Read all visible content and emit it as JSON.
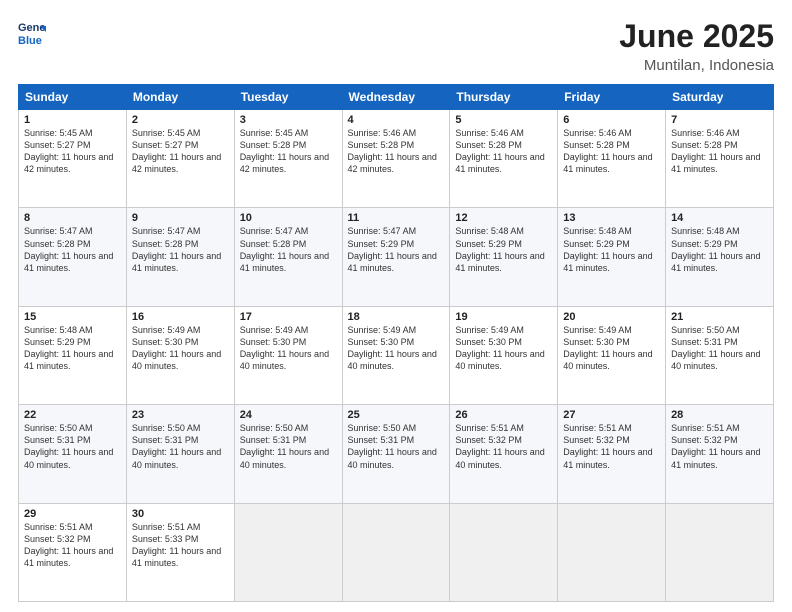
{
  "header": {
    "logo_line1": "General",
    "logo_line2": "Blue",
    "title": "June 2025",
    "subtitle": "Muntilan, Indonesia"
  },
  "days_of_week": [
    "Sunday",
    "Monday",
    "Tuesday",
    "Wednesday",
    "Thursday",
    "Friday",
    "Saturday"
  ],
  "weeks": [
    [
      {
        "day": "1",
        "sunrise": "5:45 AM",
        "sunset": "5:27 PM",
        "daylight": "11 hours and 42 minutes."
      },
      {
        "day": "2",
        "sunrise": "5:45 AM",
        "sunset": "5:27 PM",
        "daylight": "11 hours and 42 minutes."
      },
      {
        "day": "3",
        "sunrise": "5:45 AM",
        "sunset": "5:28 PM",
        "daylight": "11 hours and 42 minutes."
      },
      {
        "day": "4",
        "sunrise": "5:46 AM",
        "sunset": "5:28 PM",
        "daylight": "11 hours and 42 minutes."
      },
      {
        "day": "5",
        "sunrise": "5:46 AM",
        "sunset": "5:28 PM",
        "daylight": "11 hours and 41 minutes."
      },
      {
        "day": "6",
        "sunrise": "5:46 AM",
        "sunset": "5:28 PM",
        "daylight": "11 hours and 41 minutes."
      },
      {
        "day": "7",
        "sunrise": "5:46 AM",
        "sunset": "5:28 PM",
        "daylight": "11 hours and 41 minutes."
      }
    ],
    [
      {
        "day": "8",
        "sunrise": "5:47 AM",
        "sunset": "5:28 PM",
        "daylight": "11 hours and 41 minutes."
      },
      {
        "day": "9",
        "sunrise": "5:47 AM",
        "sunset": "5:28 PM",
        "daylight": "11 hours and 41 minutes."
      },
      {
        "day": "10",
        "sunrise": "5:47 AM",
        "sunset": "5:28 PM",
        "daylight": "11 hours and 41 minutes."
      },
      {
        "day": "11",
        "sunrise": "5:47 AM",
        "sunset": "5:29 PM",
        "daylight": "11 hours and 41 minutes."
      },
      {
        "day": "12",
        "sunrise": "5:48 AM",
        "sunset": "5:29 PM",
        "daylight": "11 hours and 41 minutes."
      },
      {
        "day": "13",
        "sunrise": "5:48 AM",
        "sunset": "5:29 PM",
        "daylight": "11 hours and 41 minutes."
      },
      {
        "day": "14",
        "sunrise": "5:48 AM",
        "sunset": "5:29 PM",
        "daylight": "11 hours and 41 minutes."
      }
    ],
    [
      {
        "day": "15",
        "sunrise": "5:48 AM",
        "sunset": "5:29 PM",
        "daylight": "11 hours and 41 minutes."
      },
      {
        "day": "16",
        "sunrise": "5:49 AM",
        "sunset": "5:30 PM",
        "daylight": "11 hours and 40 minutes."
      },
      {
        "day": "17",
        "sunrise": "5:49 AM",
        "sunset": "5:30 PM",
        "daylight": "11 hours and 40 minutes."
      },
      {
        "day": "18",
        "sunrise": "5:49 AM",
        "sunset": "5:30 PM",
        "daylight": "11 hours and 40 minutes."
      },
      {
        "day": "19",
        "sunrise": "5:49 AM",
        "sunset": "5:30 PM",
        "daylight": "11 hours and 40 minutes."
      },
      {
        "day": "20",
        "sunrise": "5:49 AM",
        "sunset": "5:30 PM",
        "daylight": "11 hours and 40 minutes."
      },
      {
        "day": "21",
        "sunrise": "5:50 AM",
        "sunset": "5:31 PM",
        "daylight": "11 hours and 40 minutes."
      }
    ],
    [
      {
        "day": "22",
        "sunrise": "5:50 AM",
        "sunset": "5:31 PM",
        "daylight": "11 hours and 40 minutes."
      },
      {
        "day": "23",
        "sunrise": "5:50 AM",
        "sunset": "5:31 PM",
        "daylight": "11 hours and 40 minutes."
      },
      {
        "day": "24",
        "sunrise": "5:50 AM",
        "sunset": "5:31 PM",
        "daylight": "11 hours and 40 minutes."
      },
      {
        "day": "25",
        "sunrise": "5:50 AM",
        "sunset": "5:31 PM",
        "daylight": "11 hours and 40 minutes."
      },
      {
        "day": "26",
        "sunrise": "5:51 AM",
        "sunset": "5:32 PM",
        "daylight": "11 hours and 40 minutes."
      },
      {
        "day": "27",
        "sunrise": "5:51 AM",
        "sunset": "5:32 PM",
        "daylight": "11 hours and 41 minutes."
      },
      {
        "day": "28",
        "sunrise": "5:51 AM",
        "sunset": "5:32 PM",
        "daylight": "11 hours and 41 minutes."
      }
    ],
    [
      {
        "day": "29",
        "sunrise": "5:51 AM",
        "sunset": "5:32 PM",
        "daylight": "11 hours and 41 minutes."
      },
      {
        "day": "30",
        "sunrise": "5:51 AM",
        "sunset": "5:33 PM",
        "daylight": "11 hours and 41 minutes."
      },
      null,
      null,
      null,
      null,
      null
    ]
  ]
}
